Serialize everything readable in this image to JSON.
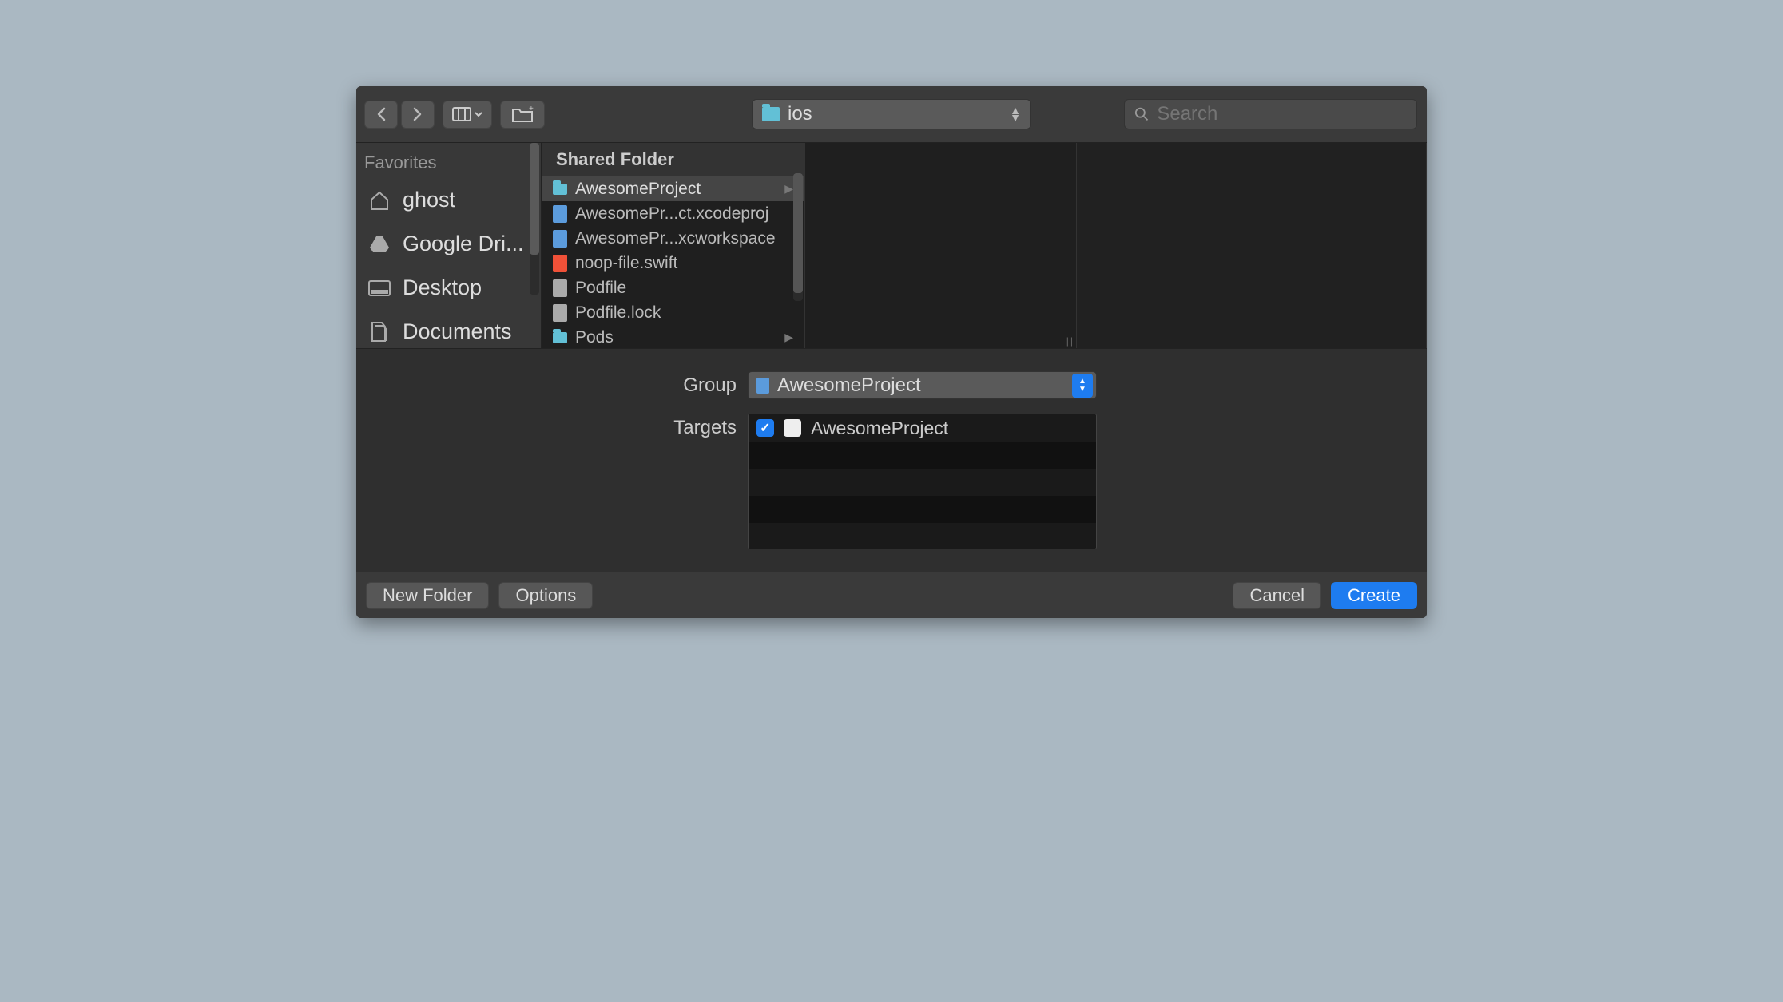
{
  "toolbar": {
    "path_label": "ios",
    "search_placeholder": "Search"
  },
  "sidebar": {
    "section": "Favorites",
    "items": [
      {
        "label": "ghost"
      },
      {
        "label": "Google Dri..."
      },
      {
        "label": "Desktop"
      },
      {
        "label": "Documents"
      }
    ]
  },
  "browser": {
    "header": "Shared Folder",
    "items": [
      {
        "label": "AwesomeProject",
        "icon": "folder",
        "has_children": true,
        "selected": true
      },
      {
        "label": "AwesomePr...ct.xcodeproj",
        "icon": "xcode",
        "has_children": false
      },
      {
        "label": "AwesomePr...xcworkspace",
        "icon": "xcode",
        "has_children": false
      },
      {
        "label": "noop-file.swift",
        "icon": "swift",
        "has_children": false
      },
      {
        "label": "Podfile",
        "icon": "file",
        "has_children": false
      },
      {
        "label": "Podfile.lock",
        "icon": "file",
        "has_children": false
      },
      {
        "label": "Pods",
        "icon": "folder",
        "has_children": true
      }
    ]
  },
  "form": {
    "group_label": "Group",
    "group_value": "AwesomeProject",
    "targets_label": "Targets",
    "targets": [
      {
        "label": "AwesomeProject",
        "checked": true
      }
    ]
  },
  "footer": {
    "new_folder": "New Folder",
    "options": "Options",
    "cancel": "Cancel",
    "create": "Create"
  }
}
